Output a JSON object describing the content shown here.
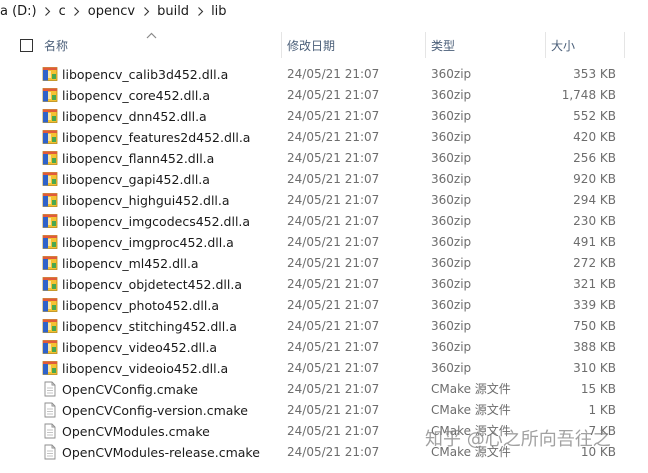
{
  "breadcrumb": [
    "a (D:)",
    "c",
    "opencv",
    "build",
    "lib"
  ],
  "columns": {
    "name": "名称",
    "date": "修改日期",
    "type": "类型",
    "size": "大小"
  },
  "files": [
    {
      "name": "libopencv_calib3d452.dll.a",
      "date": "24/05/21 21:07",
      "type": "360zip",
      "size": "353 KB",
      "icon": "archive-icon"
    },
    {
      "name": "libopencv_core452.dll.a",
      "date": "24/05/21 21:07",
      "type": "360zip",
      "size": "1,748 KB",
      "icon": "archive-icon"
    },
    {
      "name": "libopencv_dnn452.dll.a",
      "date": "24/05/21 21:07",
      "type": "360zip",
      "size": "552 KB",
      "icon": "archive-icon"
    },
    {
      "name": "libopencv_features2d452.dll.a",
      "date": "24/05/21 21:07",
      "type": "360zip",
      "size": "420 KB",
      "icon": "archive-icon"
    },
    {
      "name": "libopencv_flann452.dll.a",
      "date": "24/05/21 21:07",
      "type": "360zip",
      "size": "256 KB",
      "icon": "archive-icon"
    },
    {
      "name": "libopencv_gapi452.dll.a",
      "date": "24/05/21 21:07",
      "type": "360zip",
      "size": "920 KB",
      "icon": "archive-icon"
    },
    {
      "name": "libopencv_highgui452.dll.a",
      "date": "24/05/21 21:07",
      "type": "360zip",
      "size": "294 KB",
      "icon": "archive-icon"
    },
    {
      "name": "libopencv_imgcodecs452.dll.a",
      "date": "24/05/21 21:07",
      "type": "360zip",
      "size": "230 KB",
      "icon": "archive-icon"
    },
    {
      "name": "libopencv_imgproc452.dll.a",
      "date": "24/05/21 21:07",
      "type": "360zip",
      "size": "491 KB",
      "icon": "archive-icon"
    },
    {
      "name": "libopencv_ml452.dll.a",
      "date": "24/05/21 21:07",
      "type": "360zip",
      "size": "272 KB",
      "icon": "archive-icon"
    },
    {
      "name": "libopencv_objdetect452.dll.a",
      "date": "24/05/21 21:07",
      "type": "360zip",
      "size": "321 KB",
      "icon": "archive-icon"
    },
    {
      "name": "libopencv_photo452.dll.a",
      "date": "24/05/21 21:07",
      "type": "360zip",
      "size": "339 KB",
      "icon": "archive-icon"
    },
    {
      "name": "libopencv_stitching452.dll.a",
      "date": "24/05/21 21:07",
      "type": "360zip",
      "size": "750 KB",
      "icon": "archive-icon"
    },
    {
      "name": "libopencv_video452.dll.a",
      "date": "24/05/21 21:07",
      "type": "360zip",
      "size": "388 KB",
      "icon": "archive-icon"
    },
    {
      "name": "libopencv_videoio452.dll.a",
      "date": "24/05/21 21:07",
      "type": "360zip",
      "size": "310 KB",
      "icon": "archive-icon"
    },
    {
      "name": "OpenCVConfig.cmake",
      "date": "24/05/21 21:07",
      "type": "CMake 源文件",
      "size": "15 KB",
      "icon": "document-icon"
    },
    {
      "name": "OpenCVConfig-version.cmake",
      "date": "24/05/21 21:07",
      "type": "CMake 源文件",
      "size": "1 KB",
      "icon": "document-icon"
    },
    {
      "name": "OpenCVModules.cmake",
      "date": "24/05/21 21:07",
      "type": "CMake 源文件",
      "size": "7 KB",
      "icon": "document-icon"
    },
    {
      "name": "OpenCVModules-release.cmake",
      "date": "24/05/21 21:07",
      "type": "CMake 源文件",
      "size": "10 KB",
      "icon": "document-icon"
    }
  ],
  "watermark": "知乎 @心之所向吾往之"
}
